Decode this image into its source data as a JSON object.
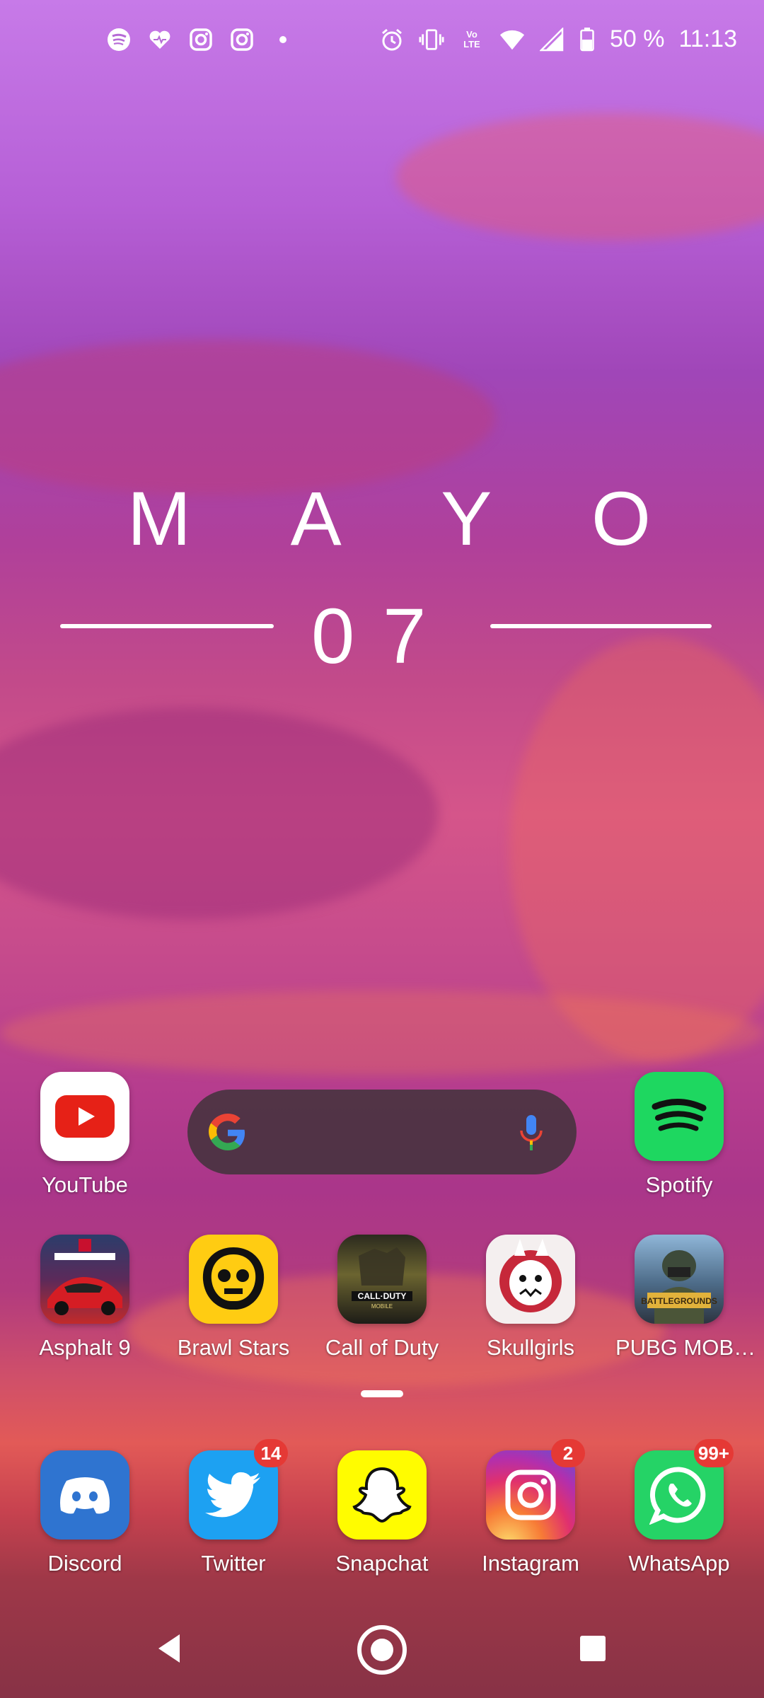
{
  "status": {
    "volte_top": "Vo",
    "volte_bottom": "LTE",
    "battery": "50 %",
    "time": "11:13",
    "notification_icons": [
      "spotify-icon",
      "health-icon",
      "instagram-icon",
      "instagram-icon",
      "dot-icon"
    ],
    "system_icons": [
      "alarm-icon",
      "vibrate-icon",
      "volte-icon",
      "wifi-icon",
      "cell-signal-icon",
      "battery-icon"
    ]
  },
  "widget": {
    "month_letters": [
      "M",
      "A",
      "Y",
      "O"
    ],
    "day": "07"
  },
  "search": {
    "icons": [
      "google-logo-icon",
      "microphone-icon"
    ]
  },
  "row1": [
    {
      "label": "YouTube",
      "icon": "youtube-icon"
    },
    {
      "label": "Spotify",
      "icon": "spotify-icon"
    }
  ],
  "row2": [
    {
      "label": "Asphalt 9",
      "icon": "asphalt-9-icon"
    },
    {
      "label": "Brawl Stars",
      "icon": "brawl-stars-icon"
    },
    {
      "label": "Call of Duty",
      "icon": "call-of-duty-icon"
    },
    {
      "label": "Skullgirls",
      "icon": "skullgirls-icon"
    },
    {
      "label": "PUBG MOB…",
      "icon": "pubg-mobile-icon"
    }
  ],
  "dock": [
    {
      "label": "Discord",
      "icon": "discord-icon"
    },
    {
      "label": "Twitter",
      "icon": "twitter-icon",
      "badge": "14"
    },
    {
      "label": "Snapchat",
      "icon": "snapchat-icon"
    },
    {
      "label": "Instagram",
      "icon": "instagram-icon",
      "badge": "2"
    },
    {
      "label": "WhatsApp",
      "icon": "whatsapp-icon",
      "badge": "99+"
    }
  ],
  "navigation": [
    "back-icon",
    "home-icon",
    "recents-icon"
  ],
  "colors": {
    "badge": "#e53935",
    "youtube": "#e62117",
    "spotify": "#1ed760",
    "discord": "#2f74d0",
    "twitter": "#1da1f2",
    "snapchat": "#fffc00",
    "whatsapp": "#25d366"
  }
}
